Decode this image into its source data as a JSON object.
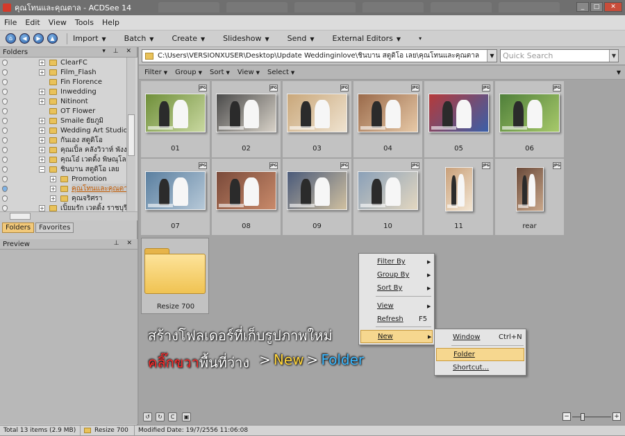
{
  "window": {
    "title": "คุณโทนและคุณตาล - ACDSee 14"
  },
  "menubar": [
    "File",
    "Edit",
    "View",
    "Tools",
    "Help"
  ],
  "toolbar": {
    "items": [
      "Import",
      "Batch",
      "Create",
      "Slideshow",
      "Send",
      "External Editors"
    ]
  },
  "folders_pane": {
    "title": "Folders",
    "tree": [
      {
        "label": "ClearFC",
        "depth": 0,
        "expander": "+",
        "selected": false
      },
      {
        "label": "Film_Flash",
        "depth": 0,
        "expander": "+",
        "selected": false
      },
      {
        "label": "Fin Florence",
        "depth": 0,
        "expander": "",
        "selected": false
      },
      {
        "label": "Inwedding",
        "depth": 0,
        "expander": "+",
        "selected": false
      },
      {
        "label": "Nitinont",
        "depth": 0,
        "expander": "+",
        "selected": false
      },
      {
        "label": "OT Flower",
        "depth": 0,
        "expander": "",
        "selected": false
      },
      {
        "label": "Smaile ยัยภูมิ",
        "depth": 0,
        "expander": "+",
        "selected": false
      },
      {
        "label": "Wedding Art Studio",
        "depth": 0,
        "expander": "+",
        "selected": false
      },
      {
        "label": "กันเอง สตูดิโอ",
        "depth": 0,
        "expander": "+",
        "selected": false
      },
      {
        "label": "คุณเปิ้ล คลังวิวาห์ พังงา",
        "depth": 0,
        "expander": "+",
        "selected": false
      },
      {
        "label": "คุณโอ๋ เวดดิ้ง พิษณุโลก",
        "depth": 0,
        "expander": "+",
        "selected": false
      },
      {
        "label": "ชินบาน สตูดิโอ เลย",
        "depth": 0,
        "expander": "−",
        "selected": false
      },
      {
        "label": "Promotion",
        "depth": 1,
        "expander": "+",
        "selected": false
      },
      {
        "label": "คุณโทนและคุณตาล",
        "depth": 1,
        "expander": "+",
        "selected": true
      },
      {
        "label": "คุณจริศรา",
        "depth": 1,
        "expander": "+",
        "selected": false
      },
      {
        "label": "เปิ้ยมรัก เวดดิ้ง ราชบุรี",
        "depth": 0,
        "expander": "+",
        "selected": false
      }
    ],
    "tabs": [
      "Folders",
      "Favorites"
    ]
  },
  "preview_pane": {
    "title": "Preview"
  },
  "path": "C:\\Users\\VERSIONXUSER\\Desktop\\Update Weddinginlove\\ชินบาน สตูดิโอ เลย\\คุณโทนและคุณตาล",
  "quick_search": {
    "placeholder": "Quick Search"
  },
  "filterbar": [
    "Filter",
    "Group",
    "Sort",
    "View",
    "Select"
  ],
  "thumbnails": [
    {
      "caption": "01",
      "badge": "JPG",
      "colors": [
        "#6f8f3a",
        "#c9d8a0"
      ],
      "portrait": false
    },
    {
      "caption": "02",
      "badge": "JPG",
      "colors": [
        "#4a4a4a",
        "#d8d2c8"
      ],
      "portrait": false
    },
    {
      "caption": "03",
      "badge": "JPG",
      "colors": [
        "#c9a77a",
        "#efe3d0"
      ],
      "portrait": false
    },
    {
      "caption": "04",
      "badge": "JPG",
      "colors": [
        "#9a6a4a",
        "#e7c9a7"
      ],
      "portrait": false
    },
    {
      "caption": "05",
      "badge": "JPG",
      "colors": [
        "#b53a3a",
        "#3a5fa8"
      ],
      "portrait": false
    },
    {
      "caption": "06",
      "badge": "JPG",
      "colors": [
        "#4f7f3a",
        "#a7c96a"
      ],
      "portrait": false
    },
    {
      "caption": "07",
      "badge": "JPG",
      "colors": [
        "#5a7fa0",
        "#b7c9d8"
      ],
      "portrait": false
    },
    {
      "caption": "08",
      "badge": "JPG",
      "colors": [
        "#7a4a3a",
        "#c98a6a"
      ],
      "portrait": false
    },
    {
      "caption": "09",
      "badge": "JPG",
      "colors": [
        "#4a5a7a",
        "#d0c0a0"
      ],
      "portrait": false
    },
    {
      "caption": "10",
      "badge": "JPG",
      "colors": [
        "#8aa0b8",
        "#e3d7c0"
      ],
      "portrait": false
    },
    {
      "caption": "11",
      "badge": "JPG",
      "colors": [
        "#c9a07a",
        "#f3e6d3"
      ],
      "portrait": true
    },
    {
      "caption": "rear",
      "badge": "JPG",
      "colors": [
        "#6a4a3a",
        "#c9a78a"
      ],
      "portrait": true
    }
  ],
  "folder_item": {
    "caption": "Resize 700"
  },
  "context_menu": {
    "items": [
      {
        "label": "Filter By",
        "submenu": true,
        "shortcut": ""
      },
      {
        "label": "Group By",
        "submenu": true,
        "shortcut": ""
      },
      {
        "label": "Sort By",
        "submenu": true,
        "shortcut": ""
      },
      {
        "label": "View",
        "submenu": true,
        "shortcut": ""
      },
      {
        "label": "Refresh",
        "submenu": false,
        "shortcut": "F5"
      },
      {
        "label": "New",
        "submenu": true,
        "shortcut": ""
      }
    ]
  },
  "submenu": {
    "items": [
      {
        "label": "Window",
        "shortcut": "Ctrl+N"
      },
      {
        "label": "Folder",
        "shortcut": ""
      },
      {
        "label": "Shortcut...",
        "shortcut": ""
      }
    ]
  },
  "annotation": {
    "line1": "สร้างโฟลเดอร์ที่เก็บรูปภาพใหม่",
    "line2_red": "คลิ๊กขวา",
    "line2_white": "พื้นที่ว่าง",
    "sep1": ">",
    "new": "New",
    "sep2": ">",
    "folder": "Folder"
  },
  "statusbar": {
    "total": "Total 13 items  (2.9 MB)",
    "current": "Resize 700",
    "modified": "Modified Date: 19/7/2556 11:06:08"
  },
  "colors": {
    "highlight": "#f6d78f",
    "accent": "#c25a00"
  }
}
